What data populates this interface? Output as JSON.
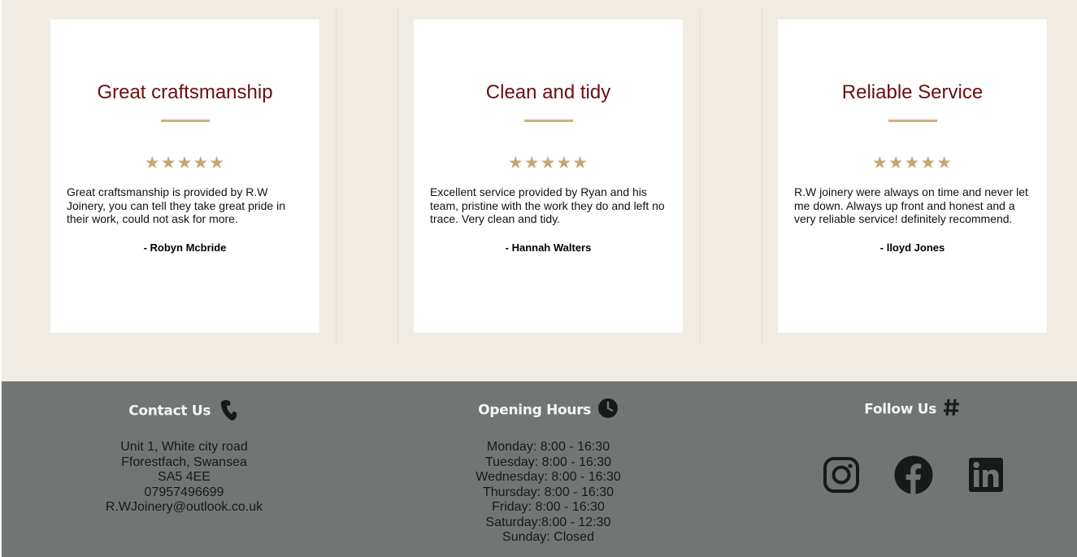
{
  "testimonials": [
    {
      "title": "Great craftsmanship",
      "stars": "★★★★★",
      "rating": 5,
      "text": "Great craftsmanship is provided by R.W Joinery, you can tell they take great pride in their work, could not ask for more.",
      "author": "- Robyn Mcbride"
    },
    {
      "title": "Clean and tidy",
      "stars": "★★★★★",
      "rating": 5,
      "text": "Excellent service provided by Ryan and his team, pristine with the work they do and left no trace. Very clean and tidy.",
      "author": "- Hannah Walters"
    },
    {
      "title": "Reliable Service",
      "stars": "★★★★★",
      "rating": 5,
      "text": "R.W joinery were always on time and never let me down. Always up front and honest and a very reliable service! definitely recommend.",
      "author": "- lloyd Jones"
    }
  ],
  "footer": {
    "contact": {
      "heading": "Contact Us",
      "icon": "phone-icon",
      "lines": [
        "Unit 1, White city road",
        "Fforestfach, Swansea",
        "SA5 4EE",
        "07957496699",
        "R.WJoinery@outlook.co.uk"
      ]
    },
    "hours": {
      "heading": "Opening Hours",
      "icon": "clock-icon",
      "lines": [
        "Monday: 8:00 - 16:30",
        "Tuesday: 8:00 - 16:30",
        "Wednesday: 8:00 - 16:30",
        "Thursday: 8:00 - 16:30",
        "Friday: 8:00 - 16:30",
        "Saturday:8:00 - 12:30",
        "Sunday: Closed"
      ]
    },
    "follow": {
      "heading": "Follow Us",
      "icon": "hashtag-icon",
      "networks": [
        "instagram-icon",
        "facebook-icon",
        "linkedin-icon"
      ]
    }
  },
  "colors": {
    "page_bg": "#f0ebe3",
    "title": "#6b0f0f",
    "accent": "#d2b07a",
    "footer_bg": "#717574",
    "icon": "#161a1b"
  }
}
